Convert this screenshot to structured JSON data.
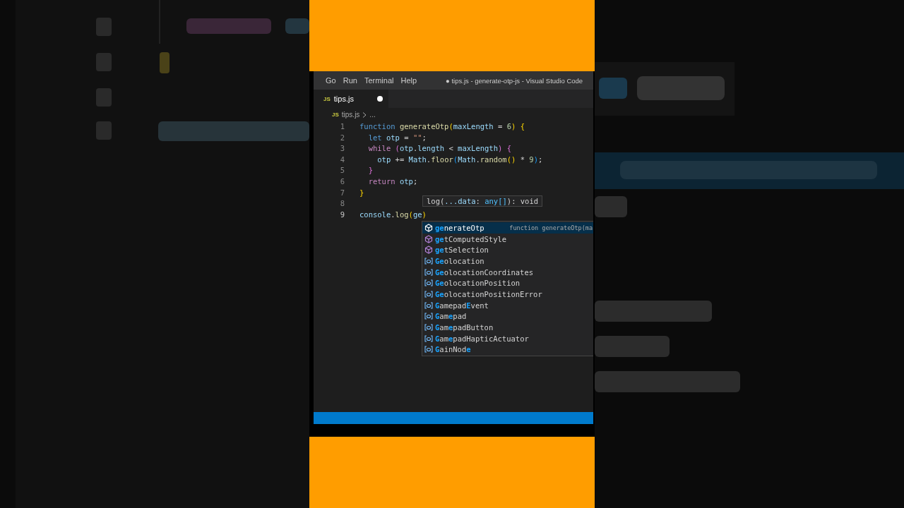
{
  "menu_items": [
    "Go",
    "Run",
    "Terminal",
    "Help"
  ],
  "window": {
    "title": "● tips.js - generate-otp-js - Visual Studio Code"
  },
  "tabs": [
    {
      "label": "tips.js",
      "icon_text": "JS",
      "selected": true,
      "modified": true
    }
  ],
  "breadcrumb": {
    "icon_text": "JS",
    "items": [
      "tips.js",
      "..."
    ]
  },
  "editor": {
    "lines": [
      {
        "number": "1",
        "tokens": [
          {
            "text": "function ",
            "kind": "keyword"
          },
          {
            "text": "generateOtp",
            "kind": "function"
          },
          {
            "text": "(",
            "kind": "bracket1"
          },
          {
            "text": "maxLength",
            "kind": "variable"
          },
          {
            "text": " = ",
            "kind": "plain"
          },
          {
            "text": "6",
            "kind": "number"
          },
          {
            "text": ")",
            "kind": "bracket1"
          },
          {
            "text": " {",
            "kind": "bracket1"
          }
        ]
      },
      {
        "number": "2",
        "tokens": [
          {
            "text": "  let ",
            "kind": "keyword"
          },
          {
            "text": "otp",
            "kind": "variable"
          },
          {
            "text": " = ",
            "kind": "plain"
          },
          {
            "text": "\"\"",
            "kind": "string"
          },
          {
            "text": ";",
            "kind": "plain"
          }
        ]
      },
      {
        "number": "3",
        "tokens": [
          {
            "text": "  while ",
            "kind": "control"
          },
          {
            "text": "(",
            "kind": "bracket2"
          },
          {
            "text": "otp",
            "kind": "variable"
          },
          {
            "text": ".",
            "kind": "plain"
          },
          {
            "text": "length",
            "kind": "variable"
          },
          {
            "text": " < ",
            "kind": "plain"
          },
          {
            "text": "maxLength",
            "kind": "variable"
          },
          {
            "text": ")",
            "kind": "bracket2"
          },
          {
            "text": " {",
            "kind": "bracket2"
          }
        ]
      },
      {
        "number": "4",
        "tokens": [
          {
            "text": "    otp",
            "kind": "variable"
          },
          {
            "text": " += ",
            "kind": "plain"
          },
          {
            "text": "Math",
            "kind": "variable"
          },
          {
            "text": ".",
            "kind": "plain"
          },
          {
            "text": "floor",
            "kind": "function"
          },
          {
            "text": "(",
            "kind": "bracket3"
          },
          {
            "text": "Math",
            "kind": "variable"
          },
          {
            "text": ".",
            "kind": "plain"
          },
          {
            "text": "random",
            "kind": "function"
          },
          {
            "text": "()",
            "kind": "bracket1"
          },
          {
            "text": " * ",
            "kind": "plain"
          },
          {
            "text": "9",
            "kind": "number"
          },
          {
            "text": ")",
            "kind": "bracket3"
          },
          {
            "text": ";",
            "kind": "plain"
          }
        ]
      },
      {
        "number": "5",
        "tokens": [
          {
            "text": "  }",
            "kind": "bracket2"
          }
        ]
      },
      {
        "number": "6",
        "tokens": [
          {
            "text": "  return ",
            "kind": "control"
          },
          {
            "text": "otp",
            "kind": "variable"
          },
          {
            "text": ";",
            "kind": "plain"
          }
        ]
      },
      {
        "number": "7",
        "tokens": [
          {
            "text": "}",
            "kind": "bracket1"
          }
        ]
      },
      {
        "number": "8"
      },
      {
        "number": "9",
        "tokens": [
          {
            "text": "console",
            "kind": "variable"
          },
          {
            "text": ".",
            "kind": "plain"
          },
          {
            "text": "log",
            "kind": "function"
          },
          {
            "text": "(",
            "kind": "bracket1"
          },
          {
            "text": "ge",
            "kind": "variable"
          },
          {
            "text": ")",
            "kind": "bracket1"
          }
        ]
      }
    ]
  },
  "hover": {
    "tokens": [
      {
        "text": "log(",
        "kind": "plain"
      },
      {
        "text": "...data",
        "kind": "param"
      },
      {
        "text": ": ",
        "kind": "plain"
      },
      {
        "text": "any[]",
        "kind": "type"
      },
      {
        "text": "): void",
        "kind": "plain"
      }
    ]
  },
  "suggestions": [
    {
      "label": "**ge**nerateOtp",
      "kind": "method",
      "selected": true,
      "detail": "function generateOtp(ma"
    },
    {
      "label": "**ge**tComputedStyle",
      "kind": "method",
      "selected": false
    },
    {
      "label": "**ge**tSelection",
      "kind": "method",
      "selected": false
    },
    {
      "label": "**Ge**olocation",
      "kind": "variable",
      "selected": false
    },
    {
      "label": "**Ge**olocationCoordinates",
      "kind": "variable",
      "selected": false
    },
    {
      "label": "**Ge**olocationPosition",
      "kind": "variable",
      "selected": false
    },
    {
      "label": "**Ge**olocationPositionError",
      "kind": "variable",
      "selected": false
    },
    {
      "label": "**G**amepad**E**vent",
      "kind": "variable",
      "selected": false
    },
    {
      "label": "**G**am**e**pad",
      "kind": "variable",
      "selected": false
    },
    {
      "label": "**G**am**e**padButton",
      "kind": "variable",
      "selected": false
    },
    {
      "label": "**G**am**e**padHapticActuator",
      "kind": "variable",
      "selected": false
    },
    {
      "label": "**G**ainNod**e**",
      "kind": "variable",
      "selected": false
    }
  ]
}
